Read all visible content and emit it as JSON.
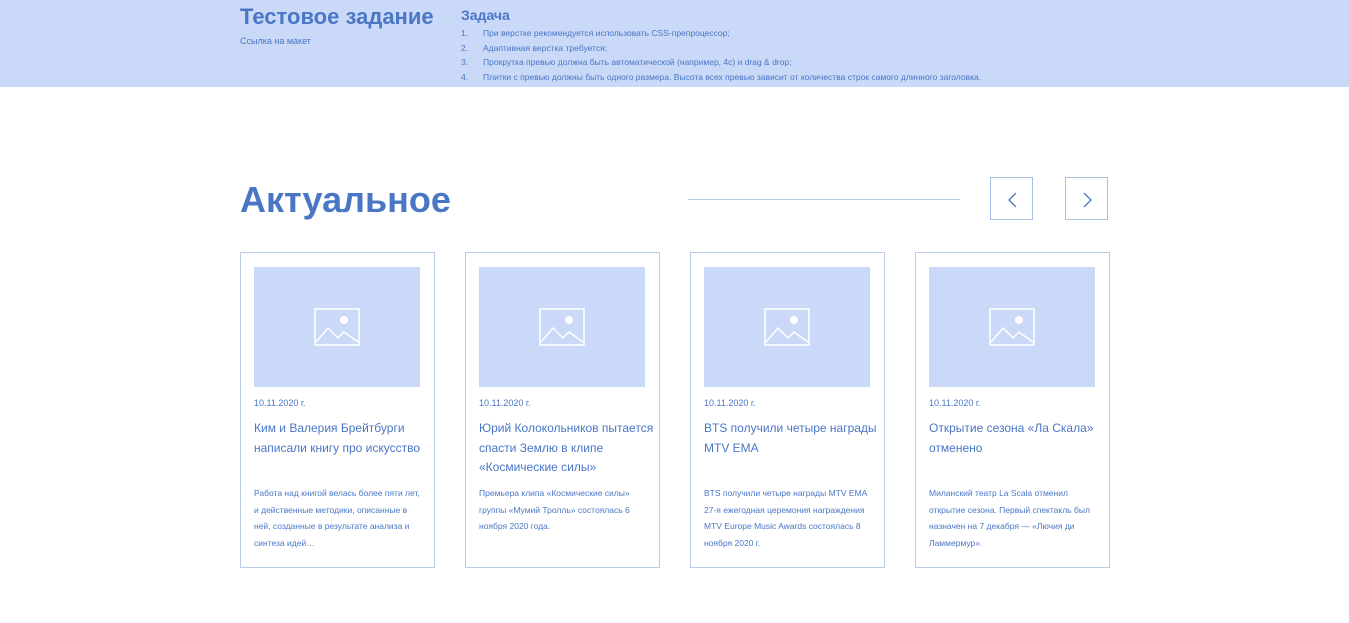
{
  "header": {
    "title": "Тестовое задание",
    "link_text": "Ссылка на макет",
    "task_title": "Задача",
    "tasks": [
      {
        "num": "1.",
        "text": "При верстке рекомендуется использовать CSS-препроцессор;"
      },
      {
        "num": "2.",
        "text": "Адаптивная верстка требуется;"
      },
      {
        "num": "3.",
        "text": "Прокрутка превью должна быть автоматической (например, 4с) и drag & drop;"
      },
      {
        "num": "4.",
        "text": "Плитки с превью должны быть одного размера. Высота всех превью зависит от количества строк самого длинного заголовка."
      }
    ]
  },
  "section": {
    "title": "Актуальное"
  },
  "colors": {
    "accent": "#4a76c6",
    "header_bg": "#c9d9f7",
    "border": "#b9cbe9"
  },
  "cards": [
    {
      "date": "10.11.2020 г.",
      "title": "Ким и Валерия Брейтбурги написали книгу про искусство",
      "description": "Работа над книгой велась более пяти лет, и действенные методики, описанные в ней, созданные в результате анализа и синтеза идей…"
    },
    {
      "date": "10.11.2020 г.",
      "title": "Юрий Колокольников пытается спасти Землю в клипе «Космические силы»",
      "description": "Премьера клипа «Космические силы» группы «Мумий Тролль» состоялась 6 ноября 2020 года."
    },
    {
      "date": "10.11.2020 г.",
      "title": "BTS получили четыре награды MTV EMA",
      "description": "BTS получили четыре награды MTV EMA 27-я ежегодная церемония награждения MTV Europe Music Awards состоялась 8 ноября 2020 г."
    },
    {
      "date": "10.11.2020 г.",
      "title": "Открытие сезона «Ла Скала» отменено",
      "description": "Миланский театр La Scala отменил открытие сезона. Первый спектакль был назначен на 7 декабря — «Лючия ди Ламмермур»."
    }
  ],
  "icons": {
    "prev": "chevron-left-icon",
    "next": "chevron-right-icon",
    "placeholder": "image-placeholder-icon"
  }
}
